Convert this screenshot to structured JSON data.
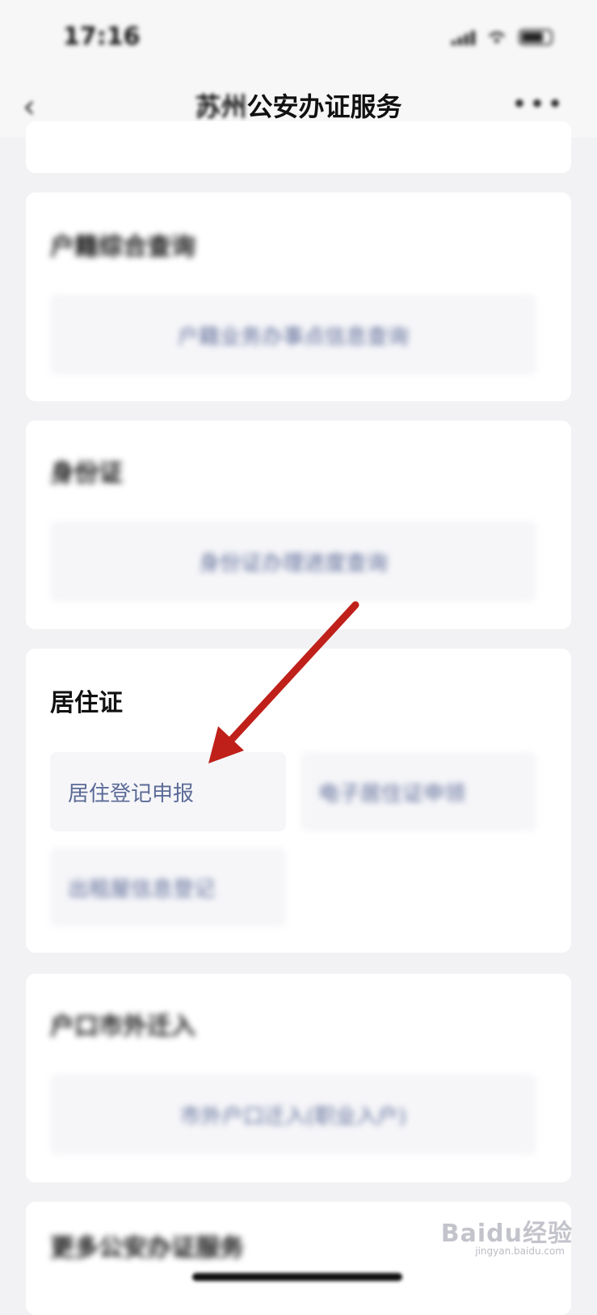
{
  "status_bar": {
    "time": "17:16"
  },
  "nav": {
    "back_icon": "chevron-left-icon",
    "title_blur": "苏州",
    "title_clear": "公安办证服务",
    "more_icon": "more-dots-icon",
    "more_glyph": "•••",
    "back_glyph": "‹"
  },
  "sections": {
    "household": {
      "title": "户籍综合查询",
      "item": "户籍业务办事点信息查询"
    },
    "id_card": {
      "title": "身份证",
      "item": "身份证办理进度查询"
    },
    "residence": {
      "title": "居住证",
      "item_1": "居住登记申报",
      "item_2": "电子居住证申领",
      "item_3": "出租屋信息登记"
    },
    "hukou_move": {
      "title": "户口市外迁入",
      "item": "市外户口迁入(职业入户)"
    },
    "more": {
      "title": "更多公安办证服务"
    }
  },
  "watermark": {
    "text": "Baidu经验",
    "sub": "jingyan.baidu.com"
  },
  "colors": {
    "arrow": "#c0201a",
    "item_text": "#5b6a96",
    "page_bg": "#f2f2f4"
  }
}
